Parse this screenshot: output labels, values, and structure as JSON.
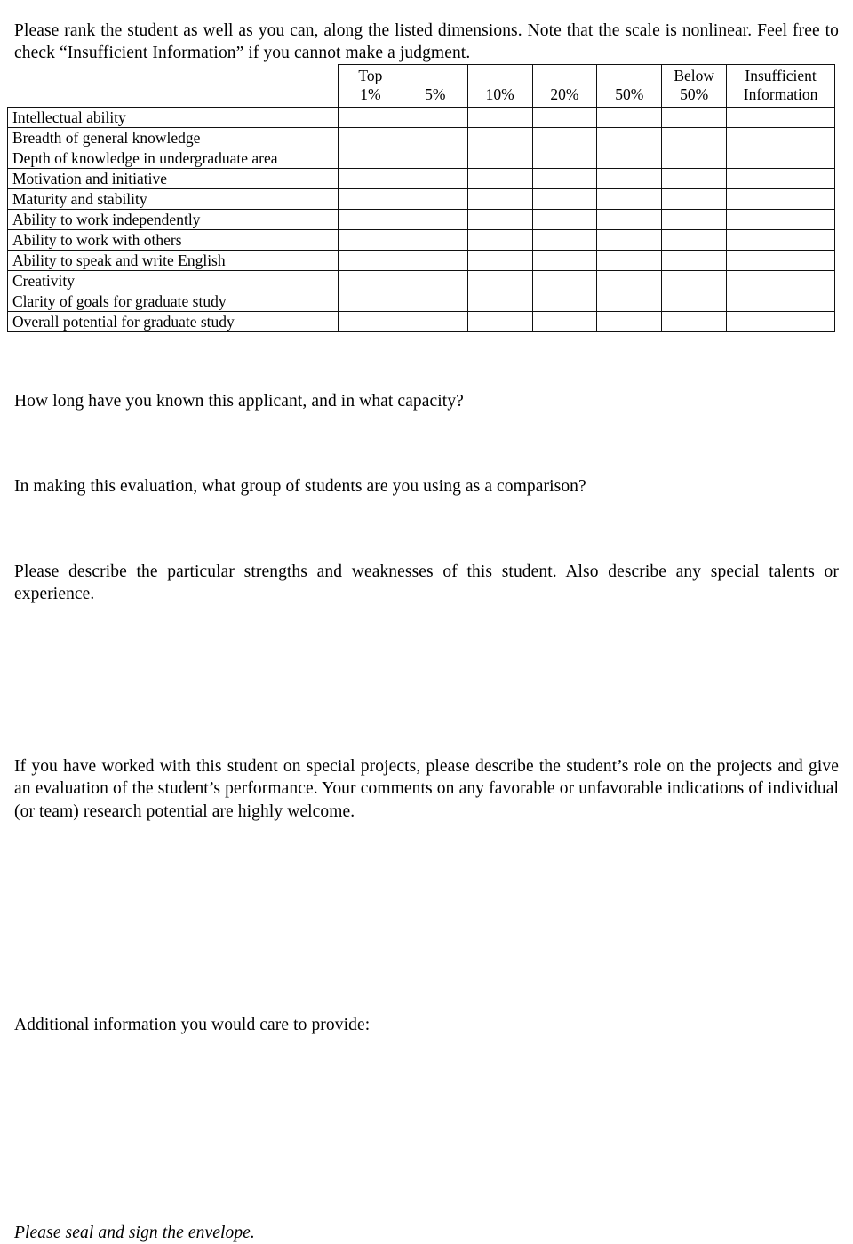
{
  "intro": {
    "text": "Please rank the student as well as you can, along the listed dimensions. Note that the scale is nonlinear. Feel free to check “Insufficient Information” if you cannot make a judgment."
  },
  "rating_table": {
    "label_column_header": "",
    "columns": [
      {
        "line1": "Top",
        "line2": "1%",
        "name": "top-1-percent"
      },
      {
        "line1": "",
        "line2": "5%",
        "name": "5-percent"
      },
      {
        "line1": "",
        "line2": "10%",
        "name": "10-percent"
      },
      {
        "line1": "",
        "line2": "20%",
        "name": "20-percent"
      },
      {
        "line1": "",
        "line2": "50%",
        "name": "50-percent"
      },
      {
        "line1": "Below",
        "line2": "50%",
        "name": "below-50-percent"
      },
      {
        "line1": "Insufficient",
        "line2": "Information",
        "name": "insufficient-information"
      }
    ],
    "rows": [
      {
        "label": "Intellectual ability"
      },
      {
        "label": "Breadth of general knowledge"
      },
      {
        "label": "Depth of knowledge in undergraduate area"
      },
      {
        "label": "Motivation and initiative"
      },
      {
        "label": "Maturity and stability"
      },
      {
        "label": "Ability to work independently"
      },
      {
        "label": "Ability to work with others"
      },
      {
        "label": "Ability to speak and write English"
      },
      {
        "label": "Creativity"
      },
      {
        "label": "Clarity of goals for graduate study"
      },
      {
        "label": "Overall potential for graduate study"
      }
    ]
  },
  "questions": {
    "q1": "How long have you known this applicant, and in what capacity?",
    "q2": "In making this evaluation, what group of students are you using as a comparison?",
    "q3": "Please describe the particular strengths and weaknesses of this student. Also describe any special talents or experience.",
    "q4": "If you have worked with this student on special projects, please describe the student’s role on the projects and give an evaluation of the student’s performance. Your comments on any favorable or unfavorable indications of individual (or team) research potential are highly welcome.",
    "q5": "Additional information you would care to provide:"
  },
  "footer": {
    "note": "Please seal and sign the envelope."
  },
  "colors": {
    "text": "#000000",
    "border": "#111111",
    "background": "#ffffff"
  }
}
